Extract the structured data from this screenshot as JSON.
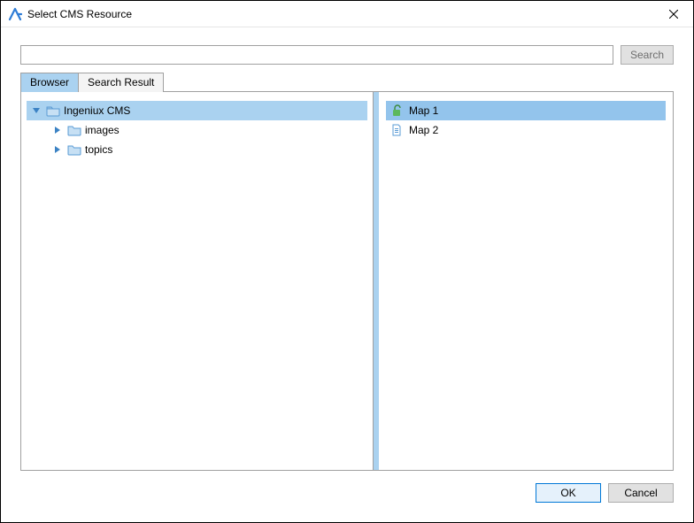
{
  "window": {
    "title": "Select CMS Resource"
  },
  "search": {
    "value": "",
    "placeholder": "",
    "button_label": "Search"
  },
  "tabs": [
    {
      "label": "Browser",
      "active": true
    },
    {
      "label": "Search Result",
      "active": false
    }
  ],
  "tree": {
    "root": {
      "label": "Ingeniux CMS",
      "expanded": true,
      "selected": true,
      "children": [
        {
          "label": "images",
          "expanded": false
        },
        {
          "label": "topics",
          "expanded": false
        }
      ]
    }
  },
  "list": {
    "items": [
      {
        "label": "Map 1",
        "icon": "unlock",
        "selected": true
      },
      {
        "label": "Map 2",
        "icon": "doc",
        "selected": false
      }
    ]
  },
  "footer": {
    "ok_label": "OK",
    "cancel_label": "Cancel"
  }
}
